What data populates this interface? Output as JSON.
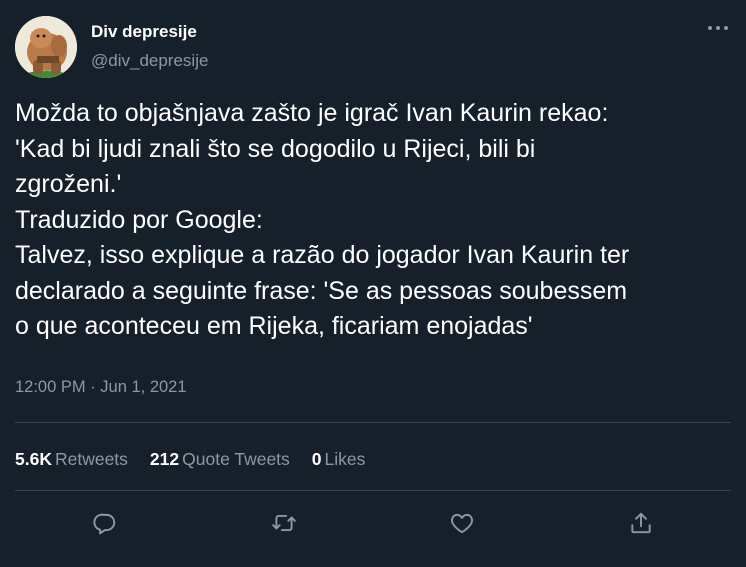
{
  "author": {
    "display_name": "Div depresije",
    "handle": "@div_depresije"
  },
  "tweet": {
    "lines": [
      "Možda to objašnjava zašto je igrač Ivan Kaurin rekao:",
      "'Kad bi ljudi znali što se dogodilo u Rijeci, bili bi",
      "zgroženi.'",
      "Traduzido por Google:",
      "Talvez, isso explique a razão do jogador Ivan Kaurin ter",
      "declarado a seguinte frase: 'Se as pessoas soubessem",
      "o que aconteceu em Rijeka, ficariam enojadas'"
    ],
    "timestamp": "12:00 PM · Jun 1, 2021"
  },
  "stats": {
    "retweets": {
      "count": "5.6K",
      "label": "Retweets"
    },
    "quote_tweets": {
      "count": "212",
      "label": "Quote Tweets"
    },
    "likes": {
      "count": "0",
      "label": "Likes"
    }
  },
  "actions": {
    "icons": [
      "reply-icon",
      "retweet-icon",
      "like-icon",
      "share-icon"
    ]
  },
  "colors": {
    "background": "#15202b",
    "primary_text": "#ffffff",
    "secondary_text": "#8899a6",
    "divider": "#38444d"
  }
}
